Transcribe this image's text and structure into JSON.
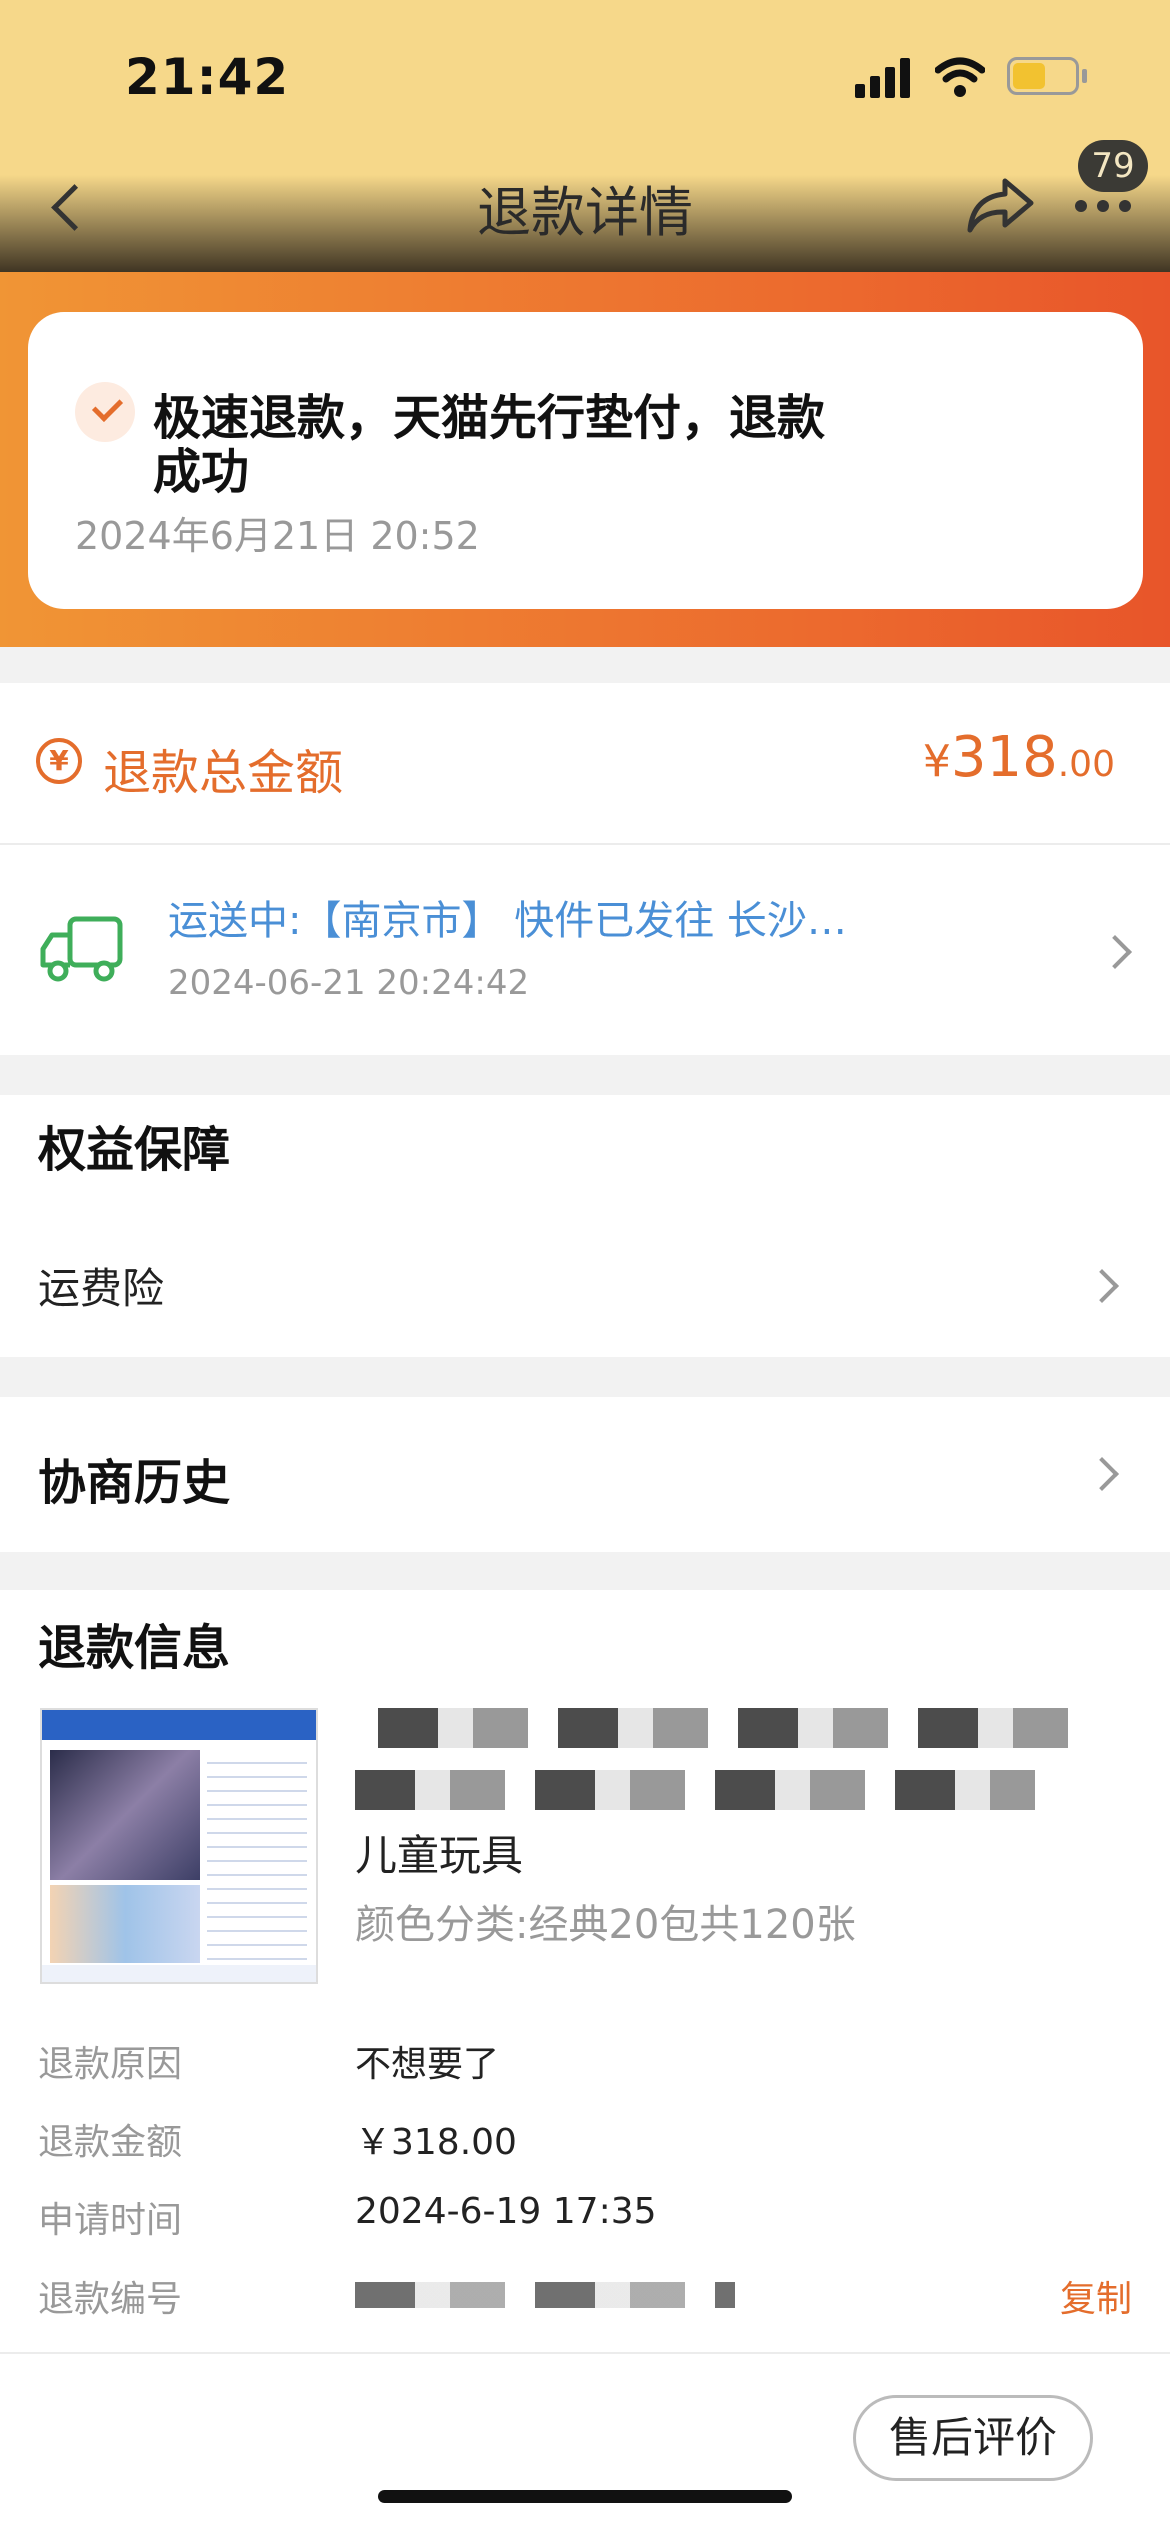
{
  "status_bar": {
    "time": "21:42"
  },
  "nav": {
    "title": "退款详情",
    "badge": "79"
  },
  "status_card": {
    "title_line1": "极速退款，天猫先行垫付，退款",
    "title_line2": "成功",
    "date": "2024年6月21日 20:52"
  },
  "refund_total": {
    "label": "退款总金额",
    "currency": "¥",
    "amount_int": "318",
    "amount_dec": ".00"
  },
  "logistics": {
    "text": "运送中:【南京市】 快件已发往 长沙…",
    "time": "2024-06-21 20:24:42"
  },
  "benefits": {
    "title": "权益保障",
    "item": "运费险"
  },
  "negotiation": {
    "title": "协商历史"
  },
  "refund_info": {
    "title": "退款信息",
    "product_name": "儿童玩具",
    "product_spec": "颜色分类:经典20包共120张",
    "rows": [
      {
        "label": "退款原因",
        "value": "不想要了"
      },
      {
        "label": "退款金额",
        "value": "￥318.00"
      },
      {
        "label": "申请时间",
        "value": "2024-6-19 17:35"
      },
      {
        "label": "退款编号",
        "value": ""
      }
    ],
    "copy_label": "复制"
  },
  "footer": {
    "review_button": "售后评价"
  },
  "colors": {
    "accent": "#e46d2c",
    "link": "#4a8fd6",
    "truck": "#3fae5a"
  }
}
